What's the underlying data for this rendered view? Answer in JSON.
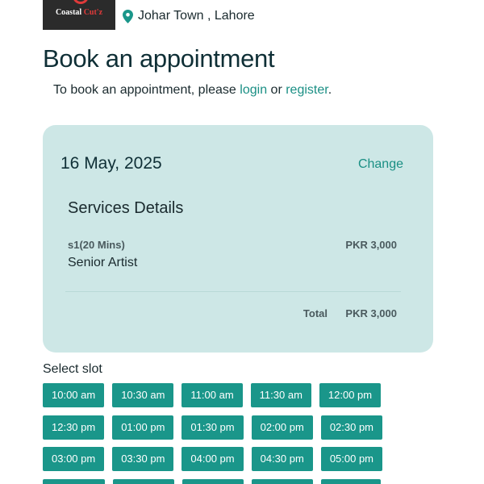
{
  "brand": {
    "logo_text_main": "Coastal ",
    "logo_text_accent": "Cut'z",
    "location": "Johar Town , Lahore",
    "pin_color": "#1a968a"
  },
  "page": {
    "title": "Book an appointment",
    "login_prefix": "To book an appointment, please ",
    "login_link": "login",
    "login_middle": " or ",
    "register_link": "register",
    "login_suffix": "."
  },
  "booking": {
    "date": "16 May, 2025",
    "change_label": "Change",
    "services_title": "Services Details",
    "service": {
      "code": "s1(20 Mins)",
      "name": "Senior Artist",
      "price": "PKR 3,000"
    },
    "total_label": "Total",
    "total_value": "PKR 3,000"
  },
  "slots": {
    "heading": "Select slot",
    "rows": [
      [
        "10:00 am",
        "10:30 am",
        "11:00 am",
        "11:30 am",
        "12:00 pm"
      ],
      [
        "12:30 pm",
        "01:00 pm",
        "01:30 pm",
        "02:00 pm",
        "02:30 pm"
      ],
      [
        "03:00 pm",
        "03:30 pm",
        "04:00 pm",
        "04:30 pm",
        "05:00 pm"
      ],
      [
        "",
        "",
        "",
        "",
        ""
      ]
    ]
  },
  "colors": {
    "accent": "#1a968a",
    "link": "#1a8f84",
    "card_bg": "#cde7e6"
  }
}
